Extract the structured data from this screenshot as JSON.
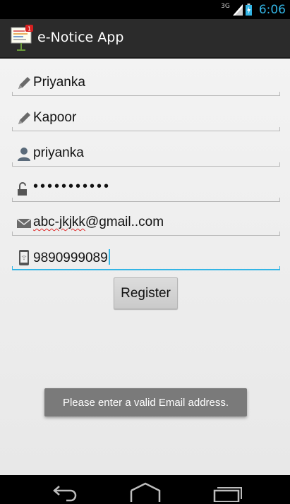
{
  "status_bar": {
    "network": "3G",
    "time": "6:06",
    "accent_color": "#33b5e5"
  },
  "action_bar": {
    "title": "e-Notice App",
    "icon": "notice-board-icon"
  },
  "form": {
    "fields": [
      {
        "icon": "pencil-icon",
        "value": "Priyanka"
      },
      {
        "icon": "pencil-icon",
        "value": "Kapoor"
      },
      {
        "icon": "person-icon",
        "value": "priyanka"
      },
      {
        "icon": "unlock-icon",
        "value": "•••••••••••"
      },
      {
        "icon": "envelope-icon",
        "value_part1": "abc-",
        "value_part2": "jkjkk",
        "value_part3": "@gmail..com"
      },
      {
        "icon": "phone-icon",
        "value": "9890999089"
      }
    ],
    "register_label": "Register"
  },
  "toast": {
    "message": "Please enter a valid Email address."
  },
  "nav_bar": {
    "back": "back-icon",
    "home": "home-icon",
    "recent": "recent-apps-icon"
  }
}
